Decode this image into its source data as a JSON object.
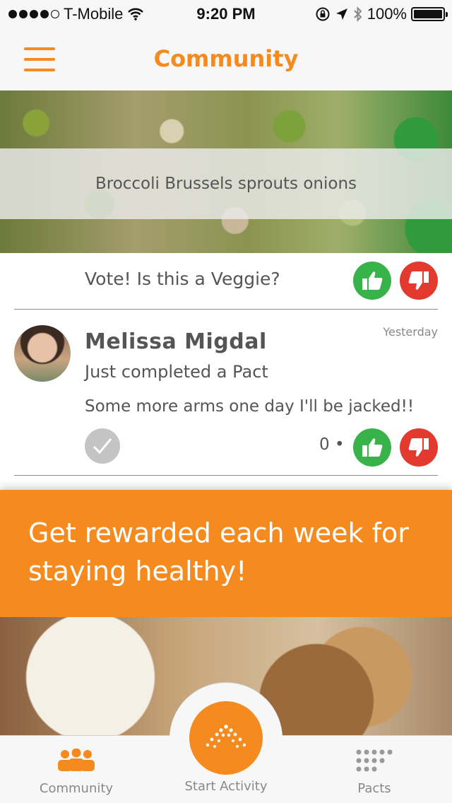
{
  "status_bar": {
    "carrier": "T-Mobile",
    "time": "9:20 PM",
    "battery": "100%"
  },
  "nav": {
    "title": "Community"
  },
  "food_post_top": {
    "caption": "Broccoli Brussels sprouts onions",
    "vote_prompt": "Vote! Is this a Veggie?"
  },
  "post": {
    "name": "Melissa Migdal",
    "time": "Yesterday",
    "subtitle": "Just completed a Pact",
    "message": "Some more arms one day I'll be jacked!!",
    "vote_count": "0 •"
  },
  "promo": {
    "text": "Get rewarded each week for staying healthy!"
  },
  "tab_bar": {
    "community_label": "Community",
    "start_label": "Start Activity",
    "pacts_label": "Pacts"
  },
  "colors": {
    "accent": "#f58a1f",
    "thumbs_up": "#37b34a",
    "thumbs_down": "#e23a2f"
  }
}
